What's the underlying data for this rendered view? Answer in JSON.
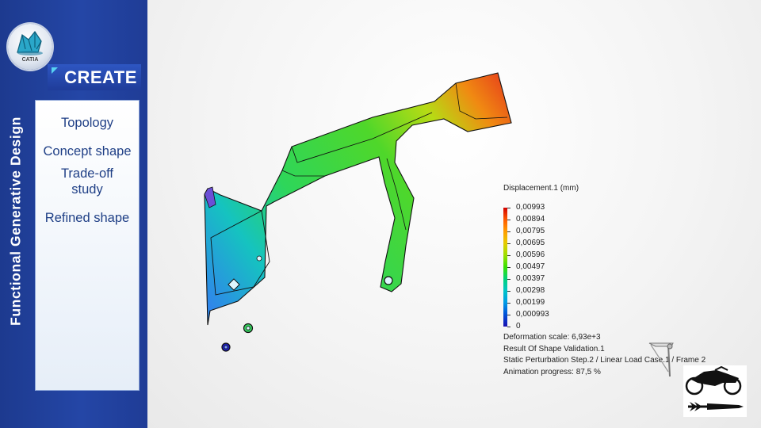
{
  "sidebar": {
    "vertical_title": "Functional Generative Design",
    "logo_text": "CATIA",
    "banner": "CREATE",
    "menu_items": [
      "Topology",
      "Concept shape",
      "Trade-off study",
      "Refined shape"
    ]
  },
  "legend": {
    "title": "Displacement.1 (mm)",
    "values": [
      "0,00993",
      "0,00894",
      "0,00795",
      "0,00695",
      "0,00596",
      "0,00497",
      "0,00397",
      "0,00298",
      "0,00199",
      "0,000993",
      "0"
    ],
    "colors": [
      "#d10000",
      "#ff5a00",
      "#ff9d00",
      "#e6cc00",
      "#9ddf00",
      "#38e000",
      "#00d27a",
      "#00c4c8",
      "#009ae6",
      "#0050d8",
      "#1a0fb0"
    ]
  },
  "info": {
    "deformation_scale": "Deformation scale: 6,93e+3",
    "result": "Result Of Shape Validation.1",
    "step": "Static Perturbation Step.2 / Linear Load Case.1 / Frame 2",
    "progress": "Animation progress: 87,5 %"
  },
  "icons": {
    "logo": "catia-logo-icon",
    "bracket": "bracket-icon",
    "motorcycle": "motorcycle-logo-icon"
  },
  "colors": {
    "sidebar": "#2446a6",
    "banner_accent": "#57d2f2",
    "menu_text": "#1f3f86"
  }
}
